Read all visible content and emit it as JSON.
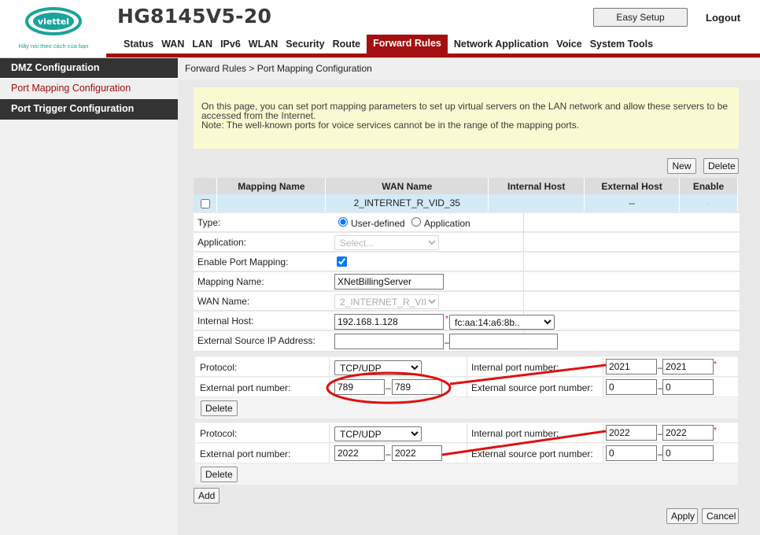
{
  "header": {
    "brand": "viettel",
    "slogan": "Hãy nói theo cách của bạn",
    "model": "HG8145V5-20",
    "easy_setup": "Easy Setup",
    "logout": "Logout",
    "nav": [
      "Status",
      "WAN",
      "LAN",
      "IPv6",
      "WLAN",
      "Security",
      "Route",
      "Forward Rules",
      "Network Application",
      "Voice",
      "System Tools"
    ],
    "active_nav": "Forward Rules",
    "accent_color": "#a50f0f"
  },
  "sidebar": {
    "items": [
      "DMZ Configuration",
      "Port Mapping Configuration",
      "Port Trigger Configuration"
    ],
    "active": "Port Mapping Configuration"
  },
  "breadcrumb": "Forward Rules > Port Mapping Configuration",
  "notice": {
    "line1": "On this page, you can set port mapping parameters to set up virtual servers on the LAN network and allow these servers to be",
    "line2": "accessed from the Internet.",
    "line3": "Note: The well-known ports for voice services cannot be in the range of the mapping ports."
  },
  "toolbar": {
    "new": "New",
    "delete": "Delete"
  },
  "table": {
    "headers": [
      "Mapping Name",
      "WAN Name",
      "Internal Host",
      "External Host",
      "Enable"
    ],
    "row": {
      "mapping_name": "",
      "wan_name": "2_INTERNET_R_VID_35",
      "internal_host": "",
      "external_host": "--",
      "enable": "-"
    }
  },
  "form": {
    "type_label": "Type:",
    "type_options": [
      "User-defined",
      "Application"
    ],
    "type_selected": "User-defined",
    "application_label": "Application:",
    "application_placeholder": "Select...",
    "enable_label": "Enable Port Mapping:",
    "enable_checked": true,
    "mapping_name_label": "Mapping Name:",
    "mapping_name_value": "XNetBillingServer",
    "wan_name_label": "WAN Name:",
    "wan_name_value": "2_INTERNET_R_VII",
    "internal_host_label": "Internal Host:",
    "internal_host_value": "192.168.1.128",
    "internal_host_mac": "fc:aa:14:a6:8b..",
    "ext_src_ip_label": "External Source IP Address:",
    "ext_src_ip_start": "",
    "ext_src_ip_end": ""
  },
  "rules": [
    {
      "protocol_label": "Protocol:",
      "protocol": "TCP/UDP",
      "int_port_label": "Internal port number:",
      "int_port_start": "2021",
      "int_port_end": "2021",
      "ext_port_label": "External port number:",
      "ext_port_start": "789",
      "ext_port_end": "789",
      "ext_src_port_label": "External source port number:",
      "ext_src_port_start": "0",
      "ext_src_port_end": "0",
      "delete": "Delete"
    },
    {
      "protocol_label": "Protocol:",
      "protocol": "TCP/UDP",
      "int_port_label": "Internal port number:",
      "int_port_start": "2022",
      "int_port_end": "2022",
      "ext_port_label": "External port number:",
      "ext_port_start": "2022",
      "ext_port_end": "2022",
      "ext_src_port_label": "External source port number:",
      "ext_src_port_start": "0",
      "ext_src_port_end": "0",
      "delete": "Delete"
    }
  ],
  "add": "Add",
  "apply": "Apply",
  "cancel": "Cancel",
  "annotation_color": "#e01010"
}
